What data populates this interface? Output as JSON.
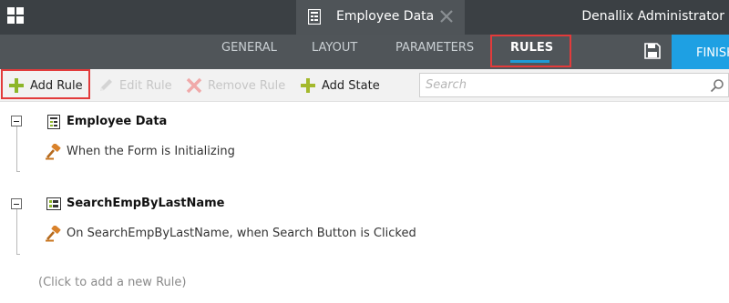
{
  "topbar": {
    "document_tab": {
      "title": "Employee Data"
    },
    "user_name": "Denallix Administrator"
  },
  "nav": {
    "tabs": [
      {
        "label": "GENERAL",
        "active": false
      },
      {
        "label": "LAYOUT",
        "active": false
      },
      {
        "label": "PARAMETERS",
        "active": false
      },
      {
        "label": "RULES",
        "active": true
      }
    ],
    "finish_label": "FINISH"
  },
  "toolbar": {
    "add_rule": "Add Rule",
    "edit_rule": "Edit Rule",
    "remove_rule": "Remove Rule",
    "add_state": "Add State",
    "search_placeholder": "Search"
  },
  "rules": [
    {
      "title": "Employee Data",
      "icon": "form-icon",
      "event": "When the Form is Initializing"
    },
    {
      "title": "SearchEmpByLastName",
      "icon": "view-icon",
      "event": "On SearchEmpByLastName, when Search Button is Clicked"
    }
  ],
  "add_new_rule": "(Click to add a new Rule)",
  "colors": {
    "topbar": "#3b4044",
    "navbar": "#505559",
    "accent": "#1ea0e3",
    "highlight": "#e23b3b",
    "add_icon": "#8db62a"
  }
}
